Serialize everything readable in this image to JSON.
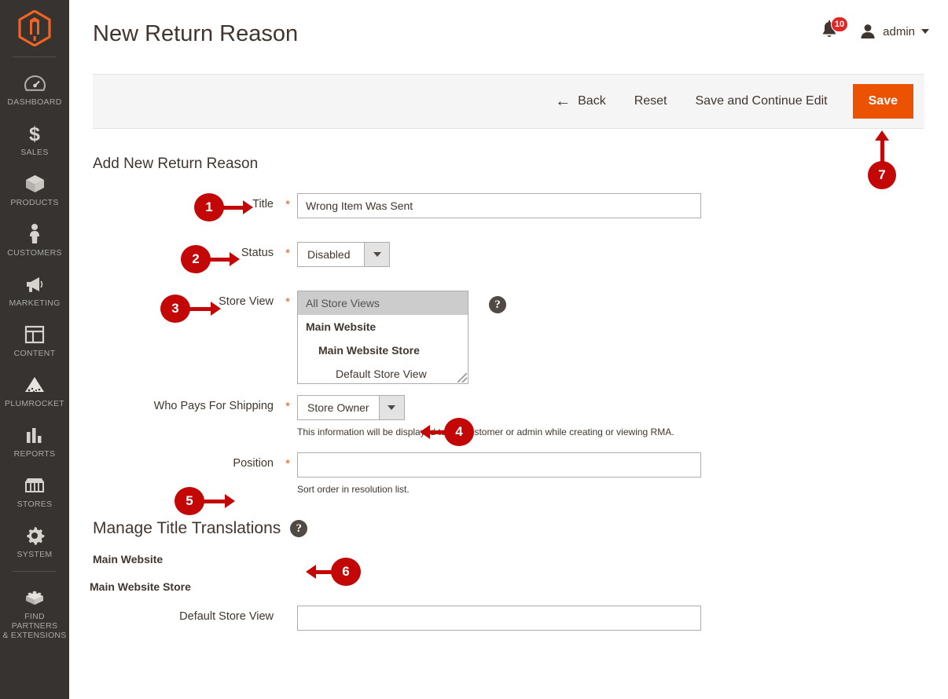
{
  "sidebar": {
    "logo": "magento-logo-icon",
    "items": [
      {
        "label": "DASHBOARD",
        "icon": "dashboard-icon"
      },
      {
        "label": "SALES",
        "icon": "dollar-icon"
      },
      {
        "label": "PRODUCTS",
        "icon": "box-icon"
      },
      {
        "label": "CUSTOMERS",
        "icon": "person-icon"
      },
      {
        "label": "MARKETING",
        "icon": "megaphone-icon"
      },
      {
        "label": "CONTENT",
        "icon": "layout-icon"
      },
      {
        "label": "PLUMROCKET",
        "icon": "plumrocket-icon"
      },
      {
        "label": "REPORTS",
        "icon": "bar-chart-icon"
      },
      {
        "label": "STORES",
        "icon": "storefront-icon"
      },
      {
        "label": "SYSTEM",
        "icon": "gear-icon"
      },
      {
        "label": "FIND PARTNERS",
        "label2": "& EXTENSIONS",
        "icon": "brick-icon"
      }
    ]
  },
  "header": {
    "title": "New Return Reason",
    "notifications_count": "10",
    "admin_name": "admin"
  },
  "toolbar": {
    "back_label": "Back",
    "back_arrow": "←",
    "reset_label": "Reset",
    "save_continue_label": "Save and Continue Edit",
    "save_label": "Save"
  },
  "form": {
    "section_title": "Add New Return Reason",
    "title_field": {
      "label": "Title",
      "required": "*",
      "value": "Wrong Item Was Sent"
    },
    "status_field": {
      "label": "Status",
      "required": "*",
      "value": "Disabled"
    },
    "store_view_field": {
      "label": "Store View",
      "required": "*",
      "options": [
        {
          "text": "All Store Views",
          "level": "selected"
        },
        {
          "text": "Main Website",
          "level": "lvl1"
        },
        {
          "text": "Main Website Store",
          "level": "lvl2"
        },
        {
          "text": "Default Store View",
          "level": "lvl3"
        }
      ],
      "help": "?"
    },
    "shipping_field": {
      "label": "Who Pays For Shipping",
      "required": "*",
      "value": "Store Owner",
      "note": "This information will be displayed to the customer or admin while creating or viewing RMA."
    },
    "position_field": {
      "label": "Position",
      "required": "*",
      "value": "",
      "note": "Sort order in resolution list."
    }
  },
  "translations": {
    "title": "Manage Title Translations",
    "help": "?",
    "website": "Main Website",
    "store": "Main Website Store",
    "store_view_label": "Default Store View",
    "store_view_value": ""
  },
  "markers": [
    {
      "num": "1"
    },
    {
      "num": "2"
    },
    {
      "num": "3"
    },
    {
      "num": "4"
    },
    {
      "num": "5"
    },
    {
      "num": "6"
    },
    {
      "num": "7"
    }
  ],
  "colors": {
    "accent_orange": "#eb5202",
    "marker_red": "#c30606",
    "sidebar_dark": "#373330",
    "badge_red": "#e22626"
  }
}
